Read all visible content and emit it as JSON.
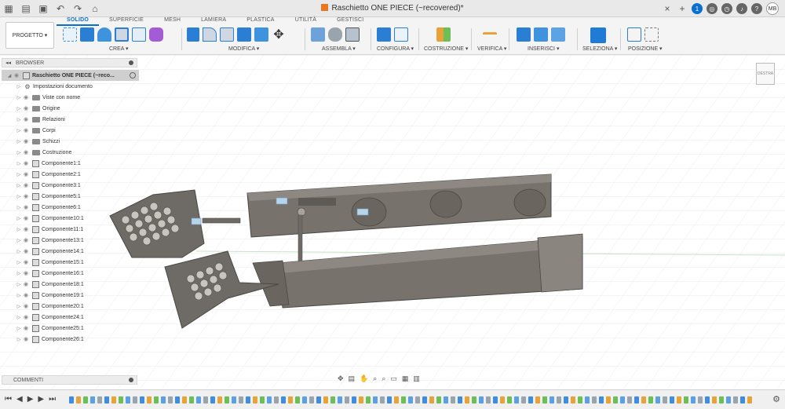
{
  "titlebar": {
    "title": "Raschietto ONE PIECE (~recovered)*",
    "user_initials": "MB",
    "counter": "1"
  },
  "ribbon": {
    "project_button": "PROGETTO ▾",
    "tabs": [
      "SOLIDO",
      "SUPERFICIE",
      "MESH",
      "LAMIERA",
      "PLASTICA",
      "UTILITÀ",
      "GESTISCI"
    ],
    "active_tab": "SOLIDO",
    "groups": [
      {
        "label": "CREA ▾"
      },
      {
        "label": "MODIFICA ▾"
      },
      {
        "label": "ASSEMBLA ▾"
      },
      {
        "label": "CONFIGURA ▾"
      },
      {
        "label": "COSTRUZIONE ▾"
      },
      {
        "label": "VERIFICA ▾"
      },
      {
        "label": "INSERISCI ▾"
      },
      {
        "label": "SELEZIONA ▾"
      },
      {
        "label": "POSIZIONE ▾"
      }
    ]
  },
  "browser": {
    "header": "BROWSER",
    "root": "Raschietto ONE PIECE (~reco...",
    "items": [
      {
        "label": "Impostazioni documento",
        "kind": "gear"
      },
      {
        "label": "Viste con nome",
        "kind": "folder"
      },
      {
        "label": "Origine",
        "kind": "folder"
      },
      {
        "label": "Relazioni",
        "kind": "folder"
      },
      {
        "label": "Corpi",
        "kind": "folder"
      },
      {
        "label": "Schizzi",
        "kind": "folder"
      },
      {
        "label": "Costruzione",
        "kind": "folder"
      },
      {
        "label": "Componente1:1",
        "kind": "comp"
      },
      {
        "label": "Componente2:1",
        "kind": "comp"
      },
      {
        "label": "Componente3:1",
        "kind": "comp"
      },
      {
        "label": "Componente5:1",
        "kind": "comp"
      },
      {
        "label": "Componente6:1",
        "kind": "comp"
      },
      {
        "label": "Componente10:1",
        "kind": "comp"
      },
      {
        "label": "Componente11:1",
        "kind": "comp"
      },
      {
        "label": "Componente13:1",
        "kind": "comp"
      },
      {
        "label": "Componente14:1",
        "kind": "comp"
      },
      {
        "label": "Componente15:1",
        "kind": "comp"
      },
      {
        "label": "Componente16:1",
        "kind": "comp"
      },
      {
        "label": "Componente18:1",
        "kind": "comp"
      },
      {
        "label": "Componente19:1",
        "kind": "comp"
      },
      {
        "label": "Componente20:1",
        "kind": "comp"
      },
      {
        "label": "Componente24:1",
        "kind": "comp"
      },
      {
        "label": "Componente25:1",
        "kind": "comp"
      },
      {
        "label": "Componente26:1",
        "kind": "comp"
      }
    ]
  },
  "comments": {
    "label": "COMMENTI"
  },
  "viewcube": {
    "label": "DESTRA"
  },
  "colors": {
    "accent": "#0b6fd0",
    "model": "#77726c",
    "background": "#ffffff"
  }
}
